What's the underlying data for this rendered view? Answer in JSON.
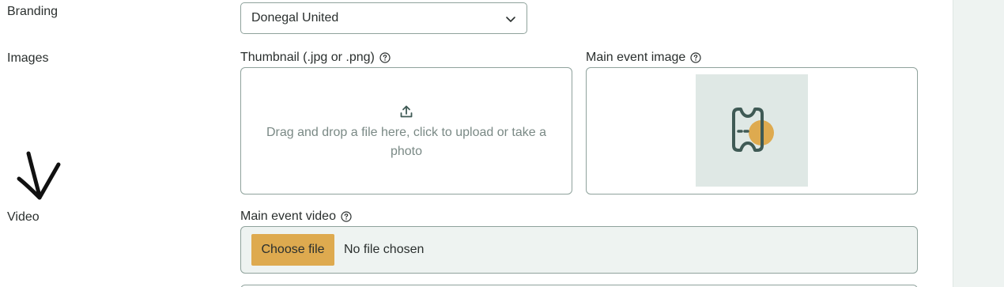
{
  "rows": {
    "branding_label": "Branding",
    "images_label": "Images",
    "video_label": "Video"
  },
  "branding": {
    "selected_value": "Donegal United"
  },
  "images": {
    "thumbnail_label": "Thumbnail (.jpg or .png)",
    "thumbnail_dropzone_text": "Drag and drop a file here, click to upload or take a photo",
    "main_image_label": "Main event image"
  },
  "video": {
    "main_video_label": "Main event video",
    "choose_file_label": "Choose file",
    "no_file_text": "No file chosen"
  },
  "colors": {
    "accent": "#deaa4f",
    "border": "#8fa29c",
    "panel_bg": "#eef3f1",
    "muted_text": "#7a8985",
    "icon": "#3f5a55"
  },
  "icons": {
    "help": "help-circle-icon",
    "chevron": "chevron-down-icon",
    "upload": "upload-icon",
    "ticket": "ticket-icon",
    "arrow": "hand-drawn-arrow-icon"
  }
}
